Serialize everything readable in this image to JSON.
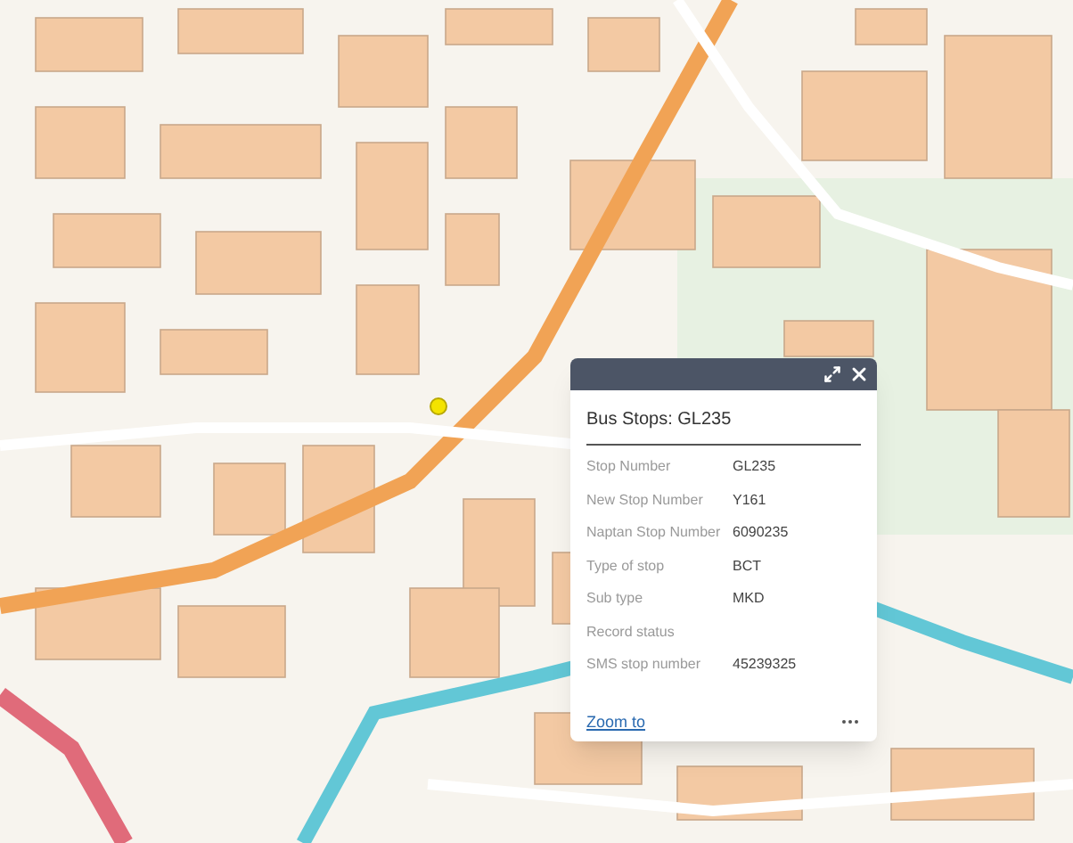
{
  "popup": {
    "title": "Bus Stops: GL235",
    "fields": [
      {
        "label": "Stop Number",
        "value": "GL235"
      },
      {
        "label": "New Stop Number",
        "value": "Y161"
      },
      {
        "label": "Naptan Stop Number",
        "value": "6090235"
      },
      {
        "label": "Type of stop",
        "value": "BCT"
      },
      {
        "label": "Sub type",
        "value": "MKD"
      },
      {
        "label": "Record status"
      },
      {
        "label": "SMS stop number",
        "value": "45239325"
      }
    ],
    "link": "Zoom to"
  }
}
